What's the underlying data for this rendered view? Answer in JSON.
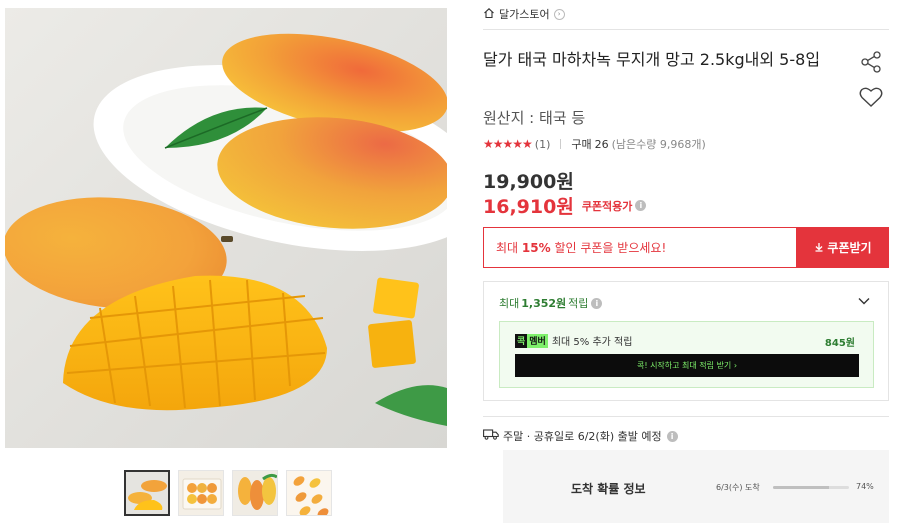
{
  "gallery": {
    "thumbnails": [
      {
        "name": "thumb-1",
        "active": true
      },
      {
        "name": "thumb-2",
        "active": false
      },
      {
        "name": "thumb-3",
        "active": false
      },
      {
        "name": "thumb-4",
        "active": false
      }
    ]
  },
  "store": {
    "name": "달가스토어",
    "home_icon": "store-home-icon",
    "chevron_icon": "chevron-right-icon"
  },
  "product": {
    "title": "달가 태국 마하차녹 무지개 망고 2.5kg내외 5-8입",
    "origin": "원산지 : 태국 등",
    "rating_stars": "★★★★★",
    "review_count": "(1)",
    "sold_label": "구매",
    "sold_count": "26",
    "remaining": "(남은수량 9,968개)",
    "share_icon": "share-icon",
    "wish_icon": "heart-icon"
  },
  "price": {
    "original": "19,900원",
    "sale": "16,910원",
    "coupon_applied": "쿠폰적용가"
  },
  "coupon": {
    "prefix": "최대 ",
    "percent": "15%",
    "suffix": " 할인 쿠폰을 받으세요!",
    "button_label": "쿠폰받기",
    "button_icon": "download-icon"
  },
  "points": {
    "prefix": "최대",
    "amount": "1,352원",
    "suffix": "적립",
    "member_badge_a": "콕",
    "member_badge_b": "멤버",
    "member_text": "최대 5% 추가 적립",
    "member_amount": "845원",
    "member_cta": "콕! 시작하고 최대 적립 받기 ›"
  },
  "delivery": {
    "text": "주말 · 공휴일로 6/2(화) 출발 예정",
    "icon": "truck-icon"
  },
  "arrival": {
    "title": "도착 확률 정보",
    "date_label": "6/3(수) 도착",
    "probability": 0.74,
    "percent_label": "74%"
  },
  "colors": {
    "accent_red": "#e4343c",
    "points_green": "#2e7d32",
    "member_green": "#7ef06b",
    "stars": "#e4343c"
  }
}
